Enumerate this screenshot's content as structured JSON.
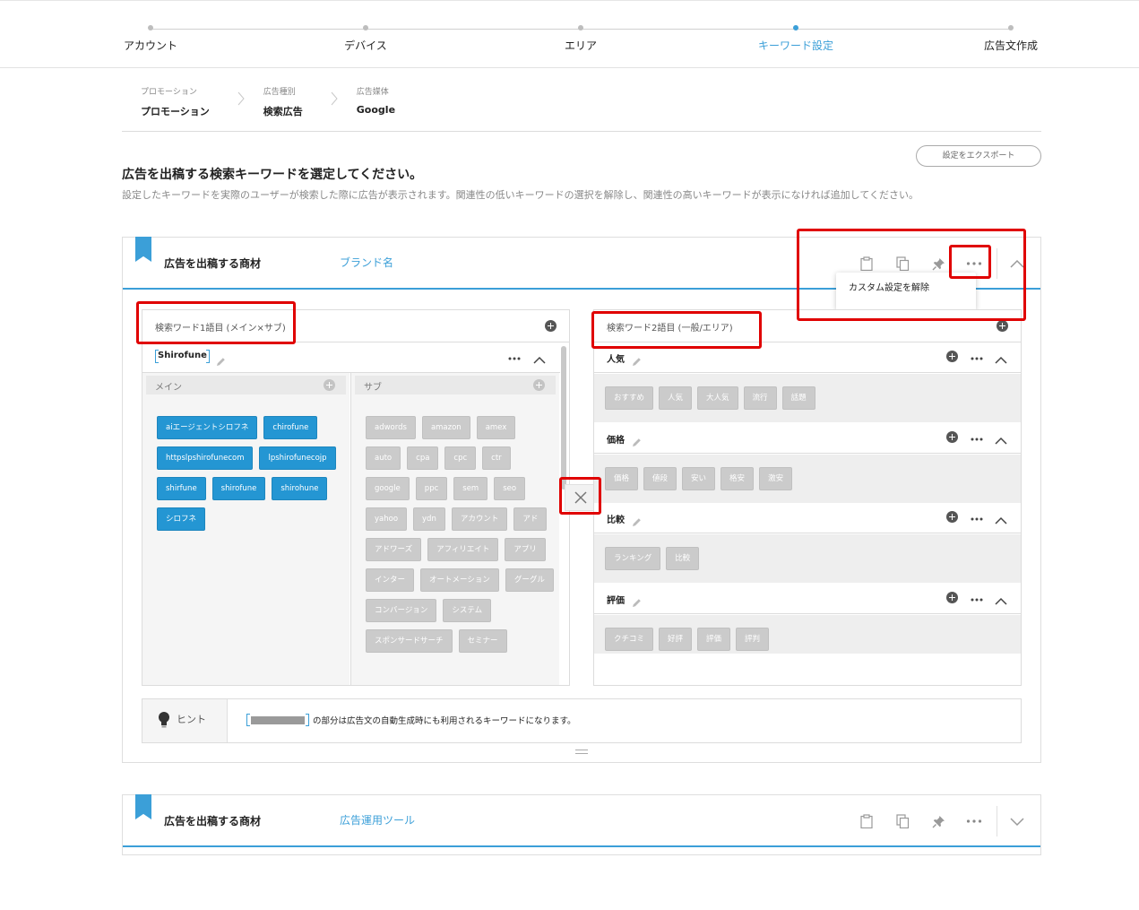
{
  "stepper": {
    "steps": [
      {
        "label": "アカウント",
        "active": false
      },
      {
        "label": "デバイス",
        "active": false
      },
      {
        "label": "エリア",
        "active": false
      },
      {
        "label": "キーワード設定",
        "active": true
      },
      {
        "label": "広告文作成",
        "active": false
      }
    ]
  },
  "breadcrumb": [
    {
      "caption": "プロモーション",
      "value": "プロモーション"
    },
    {
      "caption": "広告種別",
      "value": "検索広告"
    },
    {
      "caption": "広告媒体",
      "value": "Google"
    }
  ],
  "export_label": "設定をエクスポート",
  "page": {
    "title": "広告を出稿する検索キーワードを選定してください。",
    "description": "設定したキーワードを実際のユーザーが検索した際に広告が表示されます。関連性の低いキーワードの選択を解除し、関連性の高いキーワードが表示になければ追加してください。"
  },
  "card1": {
    "label": "広告を出稿する商材",
    "name": "ブランド名",
    "menu_item": "カスタム設定を解除",
    "left_panel": {
      "title": "検索ワード1語目 (メイン×サブ)",
      "keyword": "Shirofune",
      "main_label": "メイン",
      "sub_label": "サブ",
      "main_tags": [
        "aiエージェントシロフネ",
        "chirofune",
        "httpslpshirofunecom",
        "lpshirofunecojp",
        "shirfune",
        "shirofune",
        "shirohune",
        "シロフネ"
      ],
      "sub_tags": [
        "adwords",
        "amazon",
        "amex",
        "auto",
        "cpa",
        "cpc",
        "ctr",
        "google",
        "ppc",
        "sem",
        "seo",
        "yahoo",
        "ydn",
        "アカウント",
        "アド",
        "アドワーズ",
        "アフィリエイト",
        "アプリ",
        "インター",
        "オートメーション",
        "グーグル",
        "コンバージョン",
        "システム",
        "スポンサードサーチ",
        "セミナー"
      ]
    },
    "right_panel": {
      "title": "検索ワード2語目 (一般/エリア)",
      "groups": [
        {
          "name": "人気",
          "tags": [
            "おすすめ",
            "人気",
            "大人気",
            "流行",
            "話題"
          ]
        },
        {
          "name": "価格",
          "tags": [
            "価格",
            "値段",
            "安い",
            "格安",
            "激安"
          ]
        },
        {
          "name": "比較",
          "tags": [
            "ランキング",
            "比較"
          ]
        },
        {
          "name": "評価",
          "tags": [
            "クチコミ",
            "好評",
            "評価",
            "評判"
          ]
        }
      ]
    },
    "hint": {
      "label": "ヒント",
      "text": "の部分は広告文の自動生成時にも利用されるキーワードになります。"
    }
  },
  "card2": {
    "label": "広告を出稿する商材",
    "name": "広告運用ツール"
  },
  "icons": {
    "clipboard": "clipboard-icon",
    "copy": "copy-icon",
    "pin": "pin-icon",
    "more": "more-icon",
    "chevron": "chevron-icon",
    "bulb": "bulb-icon"
  },
  "colors": {
    "accent": "#3b9fd8",
    "tag_blue": "#2496d3",
    "tag_gray": "#cbcbcb",
    "highlight": "#e00000"
  }
}
